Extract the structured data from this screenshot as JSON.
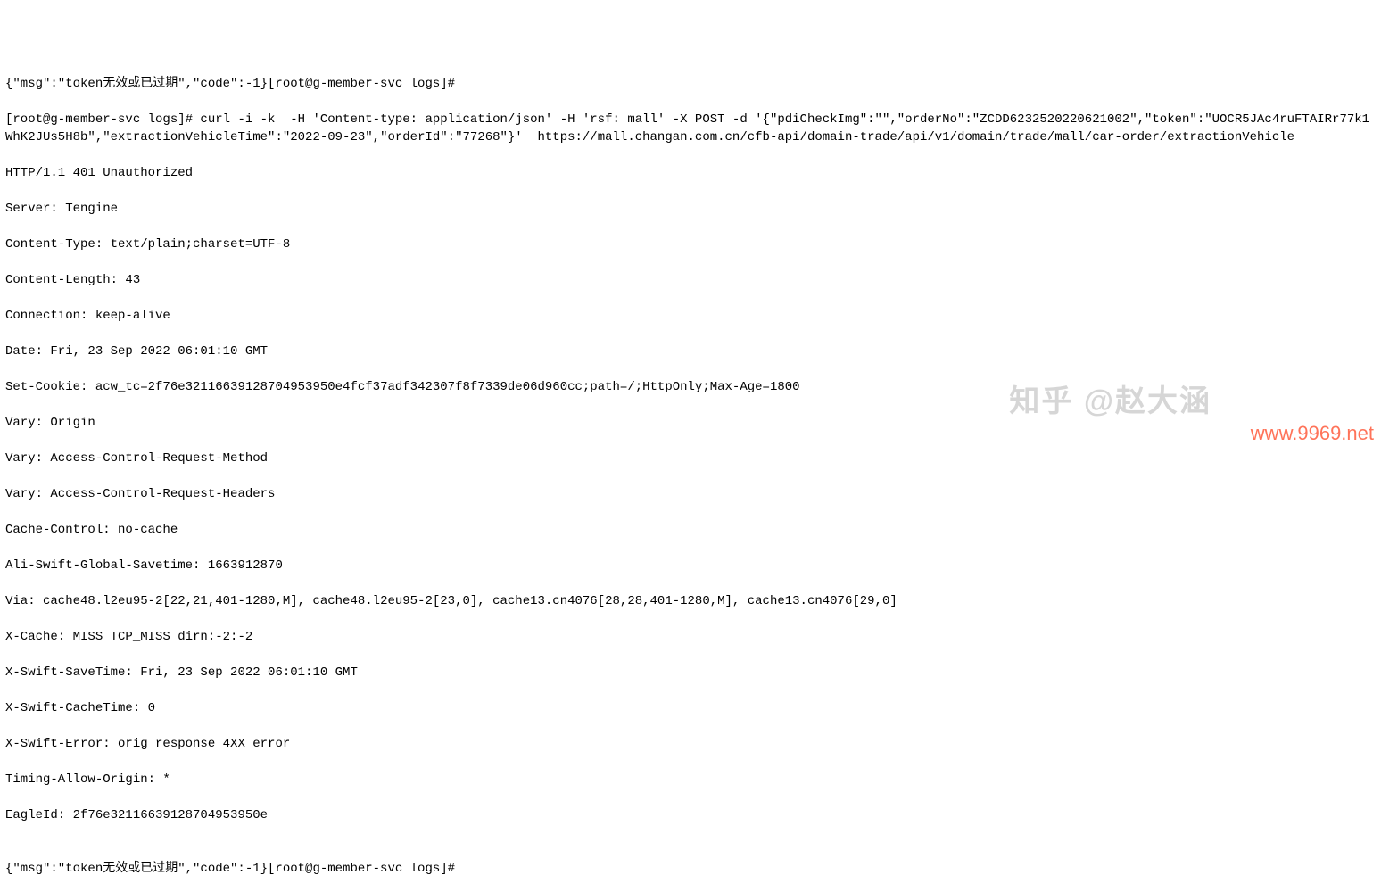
{
  "terminal": {
    "lines": [
      "{\"msg\":\"token无效或已过期\",\"code\":-1}[root@g-member-svc logs]#",
      "[root@g-member-svc logs]# curl -i -k  -H 'Content-type: application/json' -H 'rsf: mall' -X POST -d '{\"pdiCheckImg\":\"\",\"orderNo\":\"ZCDD6232520220621002\",\"token\":\"UOCR5JAc4ruFTAIRr77k1WhK2JUs5H8b\",\"extractionVehicleTime\":\"2022-09-23\",\"orderId\":\"77268\"}'  https://mall.changan.com.cn/cfb-api/domain-trade/api/v1/domain/trade/mall/car-order/extractionVehicle",
      "HTTP/1.1 401 Unauthorized",
      "Server: Tengine",
      "Content-Type: text/plain;charset=UTF-8",
      "Content-Length: 43",
      "Connection: keep-alive",
      "Date: Fri, 23 Sep 2022 06:01:10 GMT",
      "Set-Cookie: acw_tc=2f76e32116639128704953950e4fcf37adf342307f8f7339de06d960cc;path=/;HttpOnly;Max-Age=1800",
      "Vary: Origin",
      "Vary: Access-Control-Request-Method",
      "Vary: Access-Control-Request-Headers",
      "Cache-Control: no-cache",
      "Ali-Swift-Global-Savetime: 1663912870",
      "Via: cache48.l2eu95-2[22,21,401-1280,M], cache48.l2eu95-2[23,0], cache13.cn4076[28,28,401-1280,M], cache13.cn4076[29,0]",
      "X-Cache: MISS TCP_MISS dirn:-2:-2",
      "X-Swift-SaveTime: Fri, 23 Sep 2022 06:01:10 GMT",
      "X-Swift-CacheTime: 0",
      "X-Swift-Error: orig response 4XX error",
      "Timing-Allow-Origin: *",
      "EagleId: 2f76e32116639128704953950e",
      "",
      "{\"msg\":\"token无效或已过期\",\"code\":-1}[root@g-member-svc logs]#"
    ]
  },
  "watermark": {
    "zhihu": "知乎 @赵大涵",
    "site": "www.9969.net"
  }
}
